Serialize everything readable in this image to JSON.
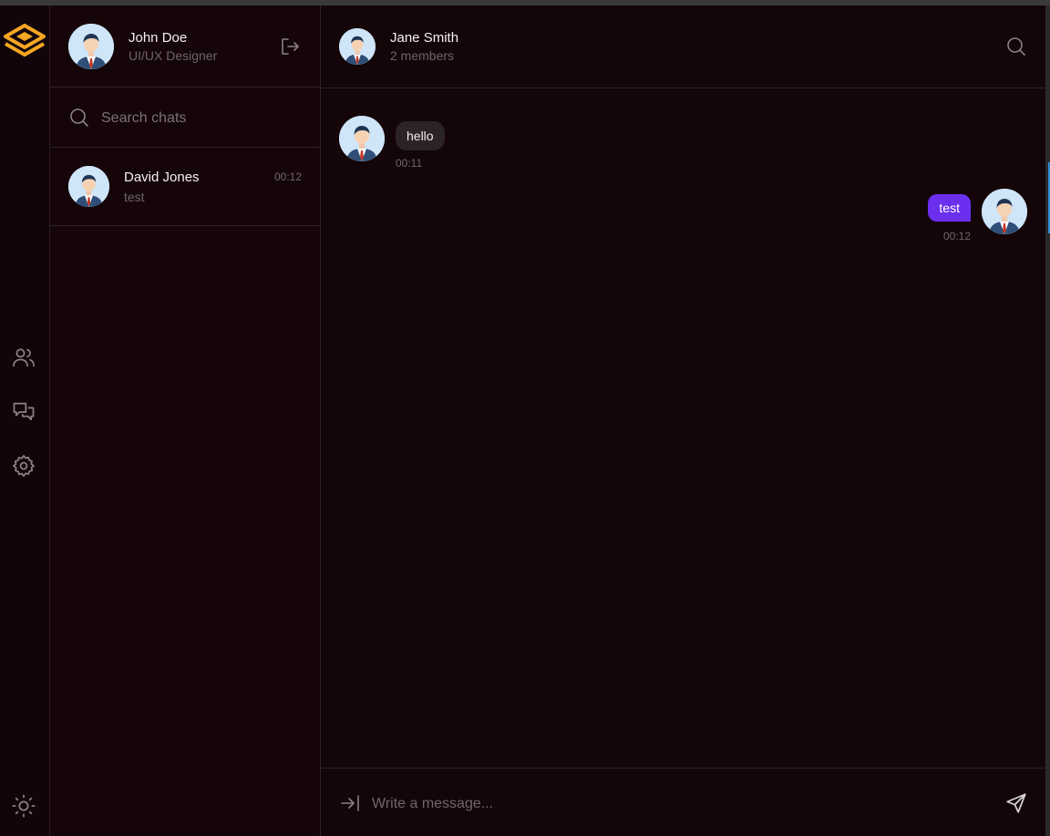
{
  "app": {
    "logo_icon": "layers-logo-icon",
    "accent": "#f5a623",
    "primary": "#6b2ff0"
  },
  "rail": {
    "nav": [
      {
        "icon": "users-icon"
      },
      {
        "icon": "chats-icon"
      },
      {
        "icon": "settings-icon"
      }
    ],
    "bottom_icon": "sun-icon"
  },
  "current_user": {
    "name": "John Doe",
    "role": "UI/UX Designer",
    "logout_icon": "logout-icon"
  },
  "search": {
    "placeholder": "Search chats",
    "icon": "search-icon"
  },
  "chats": [
    {
      "name": "David Jones",
      "last_message": "test",
      "time": "00:12"
    }
  ],
  "conversation": {
    "title": "Jane Smith",
    "subtitle": "2 members",
    "search_icon": "search-icon"
  },
  "messages": [
    {
      "direction": "incoming",
      "text": "hello",
      "time": "00:11"
    },
    {
      "direction": "outgoing",
      "text": "test",
      "time": "00:12"
    }
  ],
  "composer": {
    "placeholder": "Write a message...",
    "attach_icon": "arrow-to-line-icon",
    "send_icon": "send-icon"
  }
}
